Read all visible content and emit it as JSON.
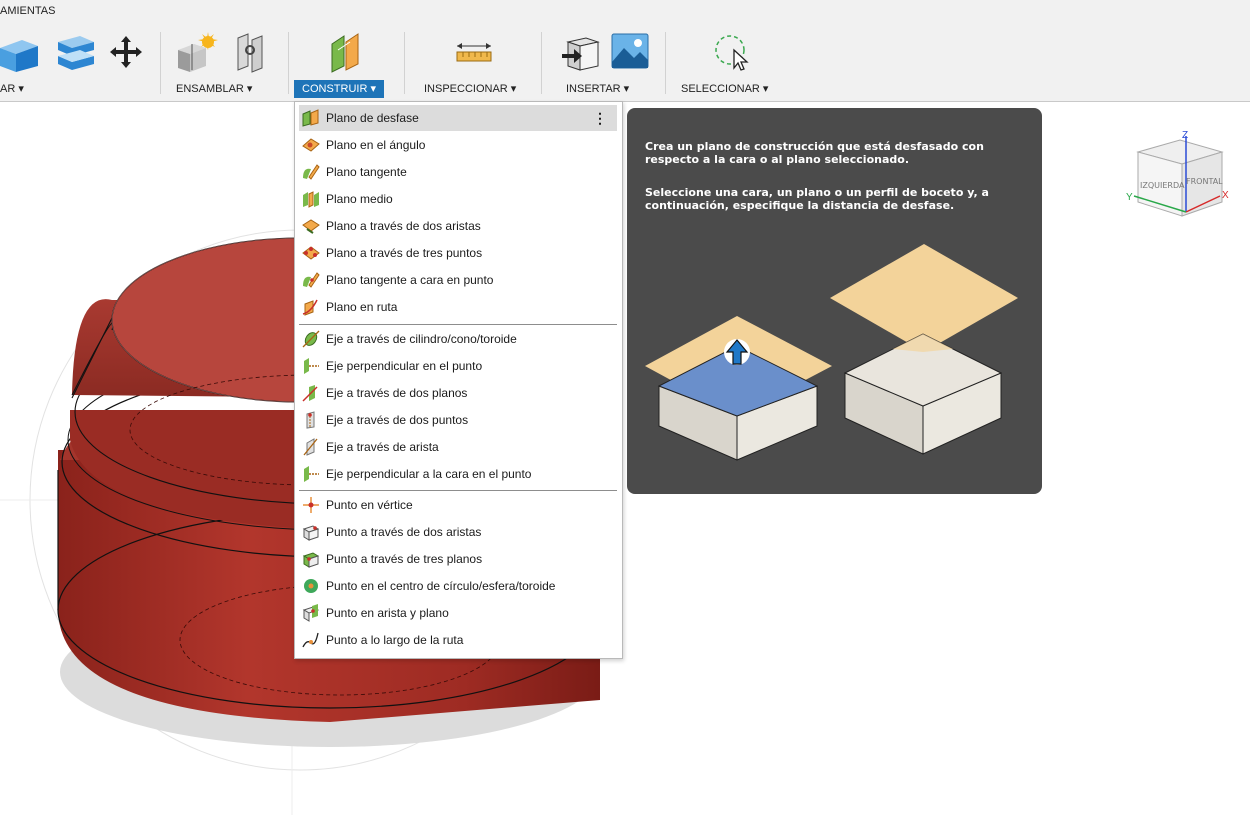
{
  "toolbar": {
    "workspace_label": "AMIENTAS",
    "groups": [
      {
        "label": "AR ▾"
      },
      {
        "label": "ENSAMBLAR ▾"
      },
      {
        "label": "CONSTRUIR ▾"
      },
      {
        "label": "INSPECCIONAR ▾"
      },
      {
        "label": "INSERTAR ▾"
      },
      {
        "label": "SELECCIONAR ▾"
      }
    ]
  },
  "menu": {
    "items": [
      {
        "label": "Plano de desfase",
        "icon": "offset-plane-icon"
      },
      {
        "label": "Plano en el ángulo",
        "icon": "plane-at-angle-icon"
      },
      {
        "label": "Plano tangente",
        "icon": "tangent-plane-icon"
      },
      {
        "label": "Plano medio",
        "icon": "midplane-icon"
      },
      {
        "label": "Plano a través de dos aristas",
        "icon": "plane-two-edges-icon"
      },
      {
        "label": "Plano a través de tres puntos",
        "icon": "plane-three-points-icon"
      },
      {
        "label": "Plano tangente a cara en punto",
        "icon": "plane-tangent-face-icon"
      },
      {
        "label": "Plano en ruta",
        "icon": "plane-along-path-icon"
      },
      {
        "label": "Eje a través de cilindro/cono/toroide",
        "icon": "axis-cylinder-icon"
      },
      {
        "label": "Eje perpendicular en el punto",
        "icon": "axis-perpendicular-point-icon"
      },
      {
        "label": "Eje a través de dos planos",
        "icon": "axis-two-planes-icon"
      },
      {
        "label": "Eje a través de dos puntos",
        "icon": "axis-two-points-icon"
      },
      {
        "label": "Eje a través de arista",
        "icon": "axis-edge-icon"
      },
      {
        "label": "Eje perpendicular a la cara en el punto",
        "icon": "axis-perpendicular-face-icon"
      },
      {
        "label": "Punto en vértice",
        "icon": "point-vertex-icon"
      },
      {
        "label": "Punto a través de dos aristas",
        "icon": "point-two-edges-icon"
      },
      {
        "label": "Punto a través de tres planos",
        "icon": "point-three-planes-icon"
      },
      {
        "label": "Punto en el centro de círculo/esfera/toroide",
        "icon": "point-center-icon"
      },
      {
        "label": "Punto en arista y plano",
        "icon": "point-edge-plane-icon"
      },
      {
        "label": "Punto a lo largo de la ruta",
        "icon": "point-along-path-icon"
      }
    ],
    "more_glyph": "⋮"
  },
  "tooltip": {
    "line1": "Crea un plano de construcción que está desfasado con respecto a la cara o al plano seleccionado.",
    "line2": "Seleccione una cara, un plano o un perfil de boceto y, a continuación, especifique la distancia de desfase."
  },
  "viewcube": {
    "face_left": "IZQUIERDA",
    "face_front": "FRONTAL",
    "axis_z": "Z",
    "axis_x": "X",
    "axis_y": "Y"
  },
  "colors": {
    "accent": "#1e74b8",
    "tooltip_bg": "#4b4b4b",
    "model": "#9c2a22"
  }
}
